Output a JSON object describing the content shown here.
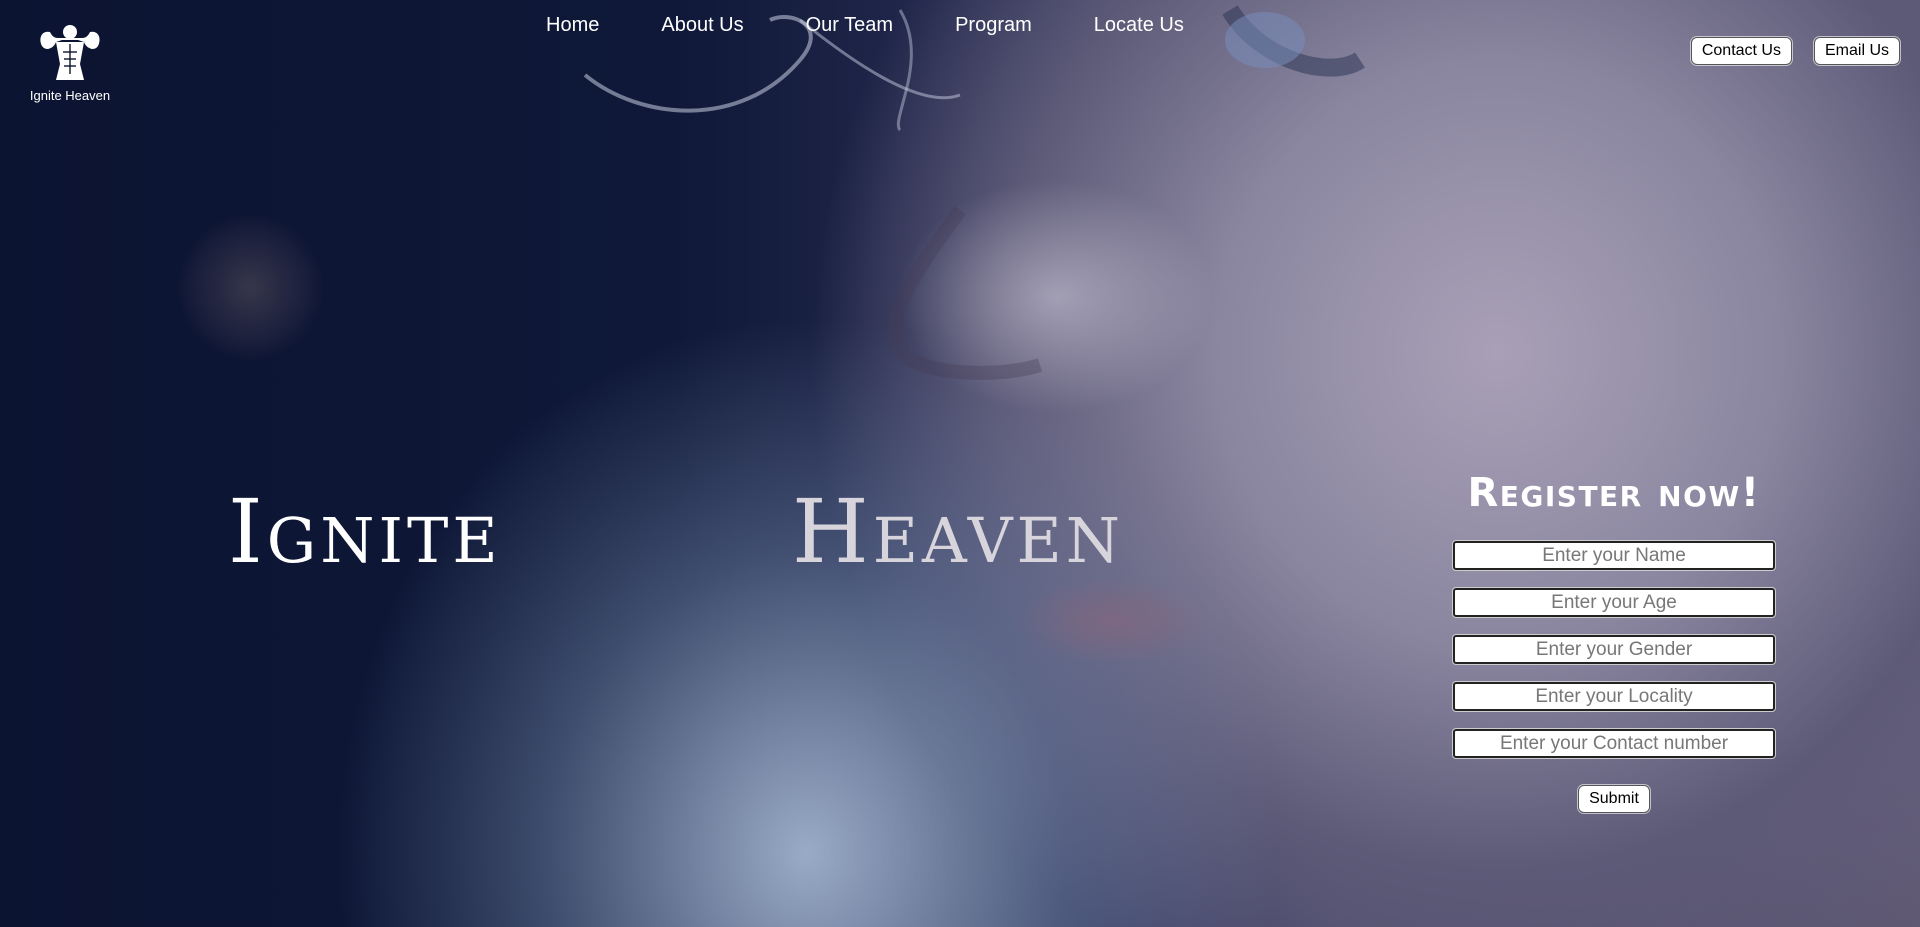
{
  "brand": {
    "name": "Ignite Heaven",
    "logo_icon": "muscleman-icon"
  },
  "nav": {
    "items": [
      {
        "label": "Home"
      },
      {
        "label": "About Us"
      },
      {
        "label": "Our Team"
      },
      {
        "label": "Program"
      },
      {
        "label": "Locate Us"
      }
    ]
  },
  "top_buttons": {
    "contact_label": "Contact Us",
    "email_label": "Email Us"
  },
  "hero": {
    "word1": "Ignite",
    "word2": "Heaven"
  },
  "register": {
    "title": "Register now!",
    "fields": [
      {
        "placeholder": "Enter your Name"
      },
      {
        "placeholder": "Enter your Age"
      },
      {
        "placeholder": "Enter your Gender"
      },
      {
        "placeholder": "Enter your Locality"
      },
      {
        "placeholder": "Enter your Contact number"
      }
    ],
    "submit_label": "Submit"
  },
  "colors": {
    "background_dark": "#0d1530",
    "text": "#ffffff",
    "hero_word2": "#d8d4dc",
    "button_bg": "#ffffff"
  }
}
